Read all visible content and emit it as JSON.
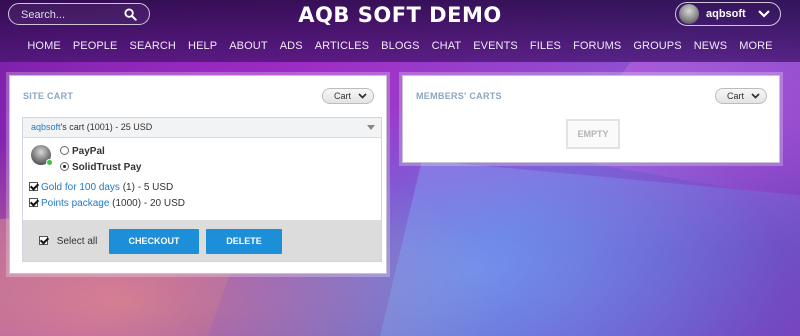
{
  "header": {
    "search": {
      "placeholder": "Search..."
    },
    "title": "AQB SOFT DEMO",
    "user": {
      "name": "aqbsoft"
    },
    "nav": [
      "HOME",
      "PEOPLE",
      "SEARCH",
      "HELP",
      "ABOUT",
      "ADS",
      "ARTICLES",
      "BLOGS",
      "CHAT",
      "EVENTS",
      "FILES",
      "FORUMS",
      "GROUPS",
      "NEWS",
      "MORE"
    ]
  },
  "site_cart": {
    "title": "SITE CART",
    "menu_label": "Cart",
    "header": {
      "owner": "aqbsoft",
      "rest": "'s cart (1001) - 25 USD"
    },
    "payment_options": [
      {
        "label": "PayPal",
        "selected": false
      },
      {
        "label": "SolidTrust Pay",
        "selected": true
      }
    ],
    "items": [
      {
        "name": "Gold for 100 days",
        "rest": " (1) - 5 USD",
        "checked": true
      },
      {
        "name": "Points package",
        "rest": " (1000) - 20 USD",
        "checked": true
      }
    ],
    "select_all_label": "Select all",
    "checkout_label": "CHECKOUT",
    "delete_label": "DELETE"
  },
  "members_carts": {
    "title": "MEMBERS' CARTS",
    "menu_label": "Cart",
    "empty_label": "EMPTY"
  },
  "colors": {
    "accent": "#1d8fd8",
    "link": "#1f79c9",
    "panel_title": "#8aa6c1"
  }
}
